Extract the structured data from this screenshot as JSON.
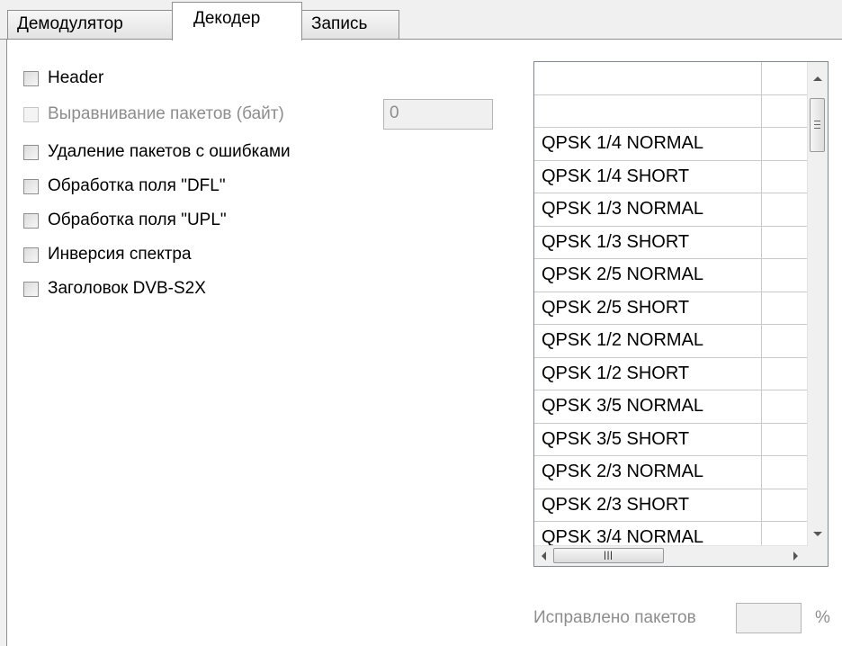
{
  "tabs": [
    {
      "label": "Демодулятор",
      "active": false
    },
    {
      "label": "Декодер",
      "active": true
    },
    {
      "label": "Запись",
      "active": false
    }
  ],
  "options": {
    "header": {
      "label": "Header",
      "checked": false
    },
    "alignment": {
      "label": "Выравнивание пакетов (байт)",
      "value": "0",
      "enabled": false
    },
    "remove_errors": {
      "label": "Удаление пакетов с ошибками",
      "checked": false
    },
    "dfl": {
      "label": "Обработка поля \"DFL\"",
      "checked": false
    },
    "upl": {
      "label": "Обработка поля \"UPL\"",
      "checked": false
    },
    "spectrum": {
      "label": "Инверсия спектра",
      "checked": false
    },
    "dvbs2x": {
      "label": "Заголовок DVB-S2X",
      "checked": false
    }
  },
  "modcod_list": {
    "rows": [
      "",
      "",
      "QPSK 1/4 NORMAL",
      "QPSK 1/4 SHORT",
      "QPSK 1/3 NORMAL",
      "QPSK 1/3 SHORT",
      "QPSK 2/5 NORMAL",
      "QPSK 2/5 SHORT",
      "QPSK 1/2 NORMAL",
      "QPSK 1/2 SHORT",
      "QPSK 3/5 NORMAL",
      "QPSK 3/5 SHORT",
      "QPSK 2/3 NORMAL",
      "QPSK 2/3 SHORT",
      "QPSK 3/4 NORMAL"
    ]
  },
  "fixed": {
    "label": "Исправлено пакетов",
    "value": "",
    "unit": "%"
  },
  "icons": {
    "scroll_up": "triangle-up",
    "scroll_down": "triangle-down",
    "scroll_left": "triangle-left",
    "scroll_right": "triangle-right"
  }
}
